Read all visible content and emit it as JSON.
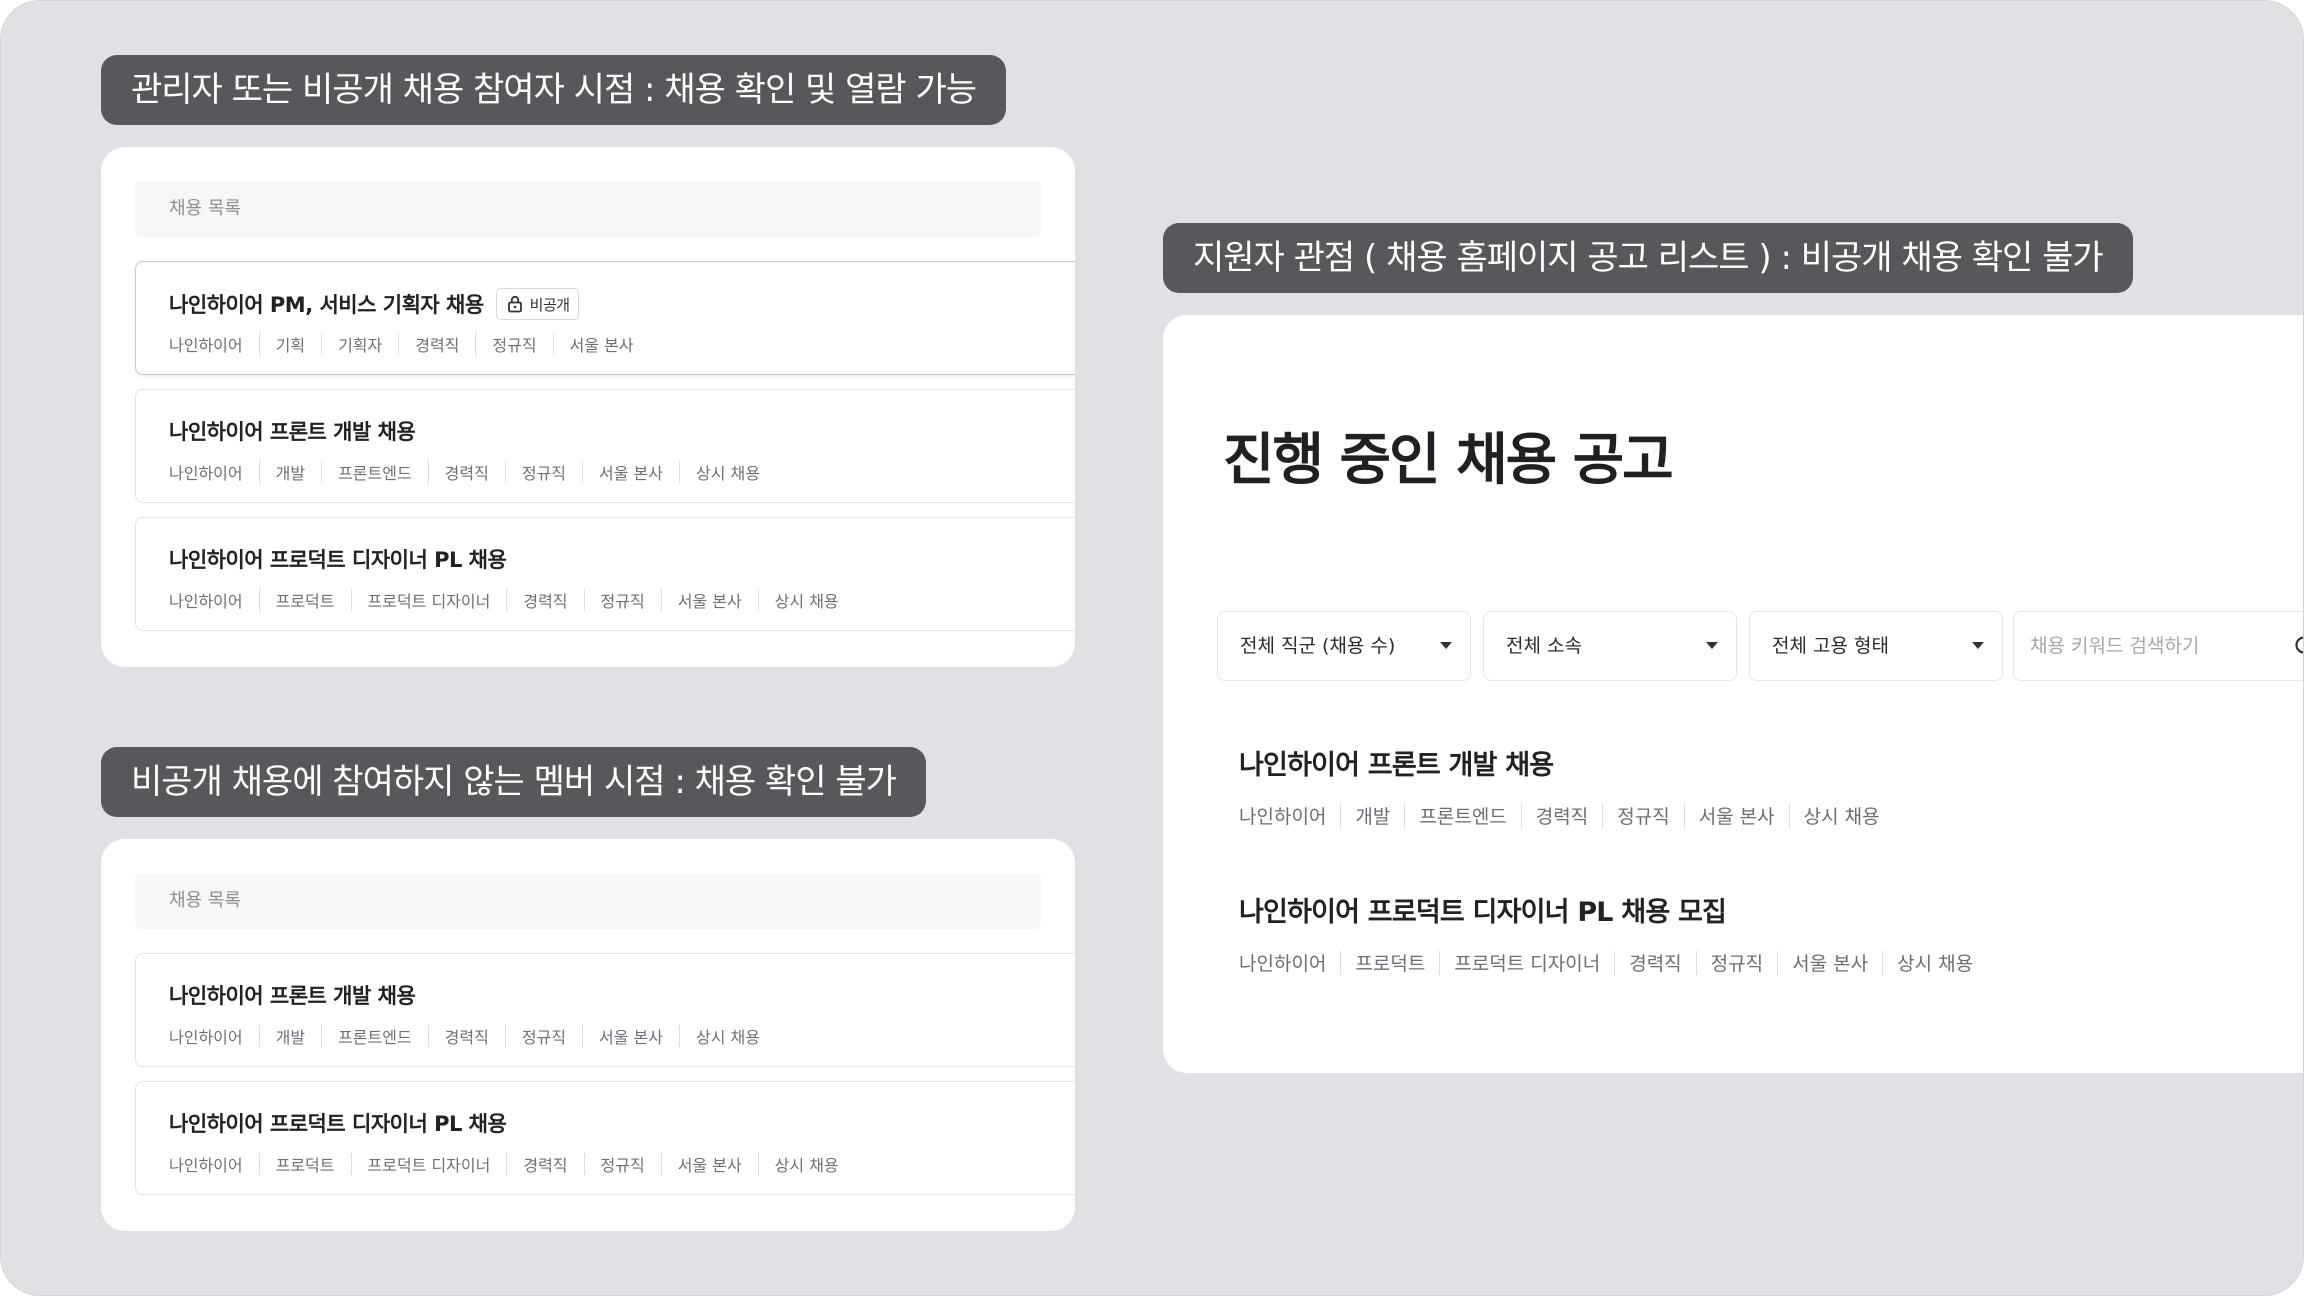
{
  "captions": {
    "admin_view": "관리자 또는 비공개 채용 참여자 시점 : 채용 확인 및 열람 가능",
    "member_view": "비공개 채용에 참여하지 않는 멤버 시점 : 채용 확인 불가",
    "applicant_view": "지원자 관점 ( 채용 홈페이지 공고 리스트 ) : 비공개 채용 확인 불가"
  },
  "admin_panel": {
    "list_header": "채용 목록",
    "jobs": [
      {
        "title": "나인하이어 PM, 서비스 기획자 채용",
        "badge": "비공개",
        "badge_icon": "lock-icon",
        "tags": [
          "나인하이어",
          "기획",
          "기획자",
          "경력직",
          "정규직",
          "서울 본사"
        ]
      },
      {
        "title": "나인하이어 프론트 개발 채용",
        "tags": [
          "나인하이어",
          "개발",
          "프론트엔드",
          "경력직",
          "정규직",
          "서울 본사",
          "상시 채용"
        ]
      },
      {
        "title": "나인하이어 프로덕트 디자이너 PL 채용",
        "tags": [
          "나인하이어",
          "프로덕트",
          "프로덕트 디자이너",
          "경력직",
          "정규직",
          "서울 본사",
          "상시 채용"
        ]
      }
    ]
  },
  "member_panel": {
    "list_header": "채용 목록",
    "jobs": [
      {
        "title": "나인하이어 프론트 개발 채용",
        "tags": [
          "나인하이어",
          "개발",
          "프론트엔드",
          "경력직",
          "정규직",
          "서울 본사",
          "상시 채용"
        ]
      },
      {
        "title": "나인하이어 프로덕트 디자이너 PL 채용",
        "tags": [
          "나인하이어",
          "프로덕트",
          "프로덕트 디자이너",
          "경력직",
          "정규직",
          "서울 본사",
          "상시 채용"
        ]
      }
    ]
  },
  "careers_page": {
    "title": "진행 중인 채용 공고",
    "filters": [
      "전체 직군 (채용 수)",
      "전체 소속",
      "전체 고용 형태"
    ],
    "search_placeholder": "채용 키워드 검색하기",
    "search_icon": "search-icon",
    "posts": [
      {
        "title": "나인하이어 프론트 개발 채용",
        "tags": [
          "나인하이어",
          "개발",
          "프론트엔드",
          "경력직",
          "정규직",
          "서울 본사",
          "상시 채용"
        ]
      },
      {
        "title": "나인하이어 프로덕트 디자이너 PL 채용 모집",
        "tags": [
          "나인하이어",
          "프로덕트",
          "프로덕트 디자이너",
          "경력직",
          "정규직",
          "서울 본사",
          "상시 채용"
        ]
      }
    ]
  }
}
